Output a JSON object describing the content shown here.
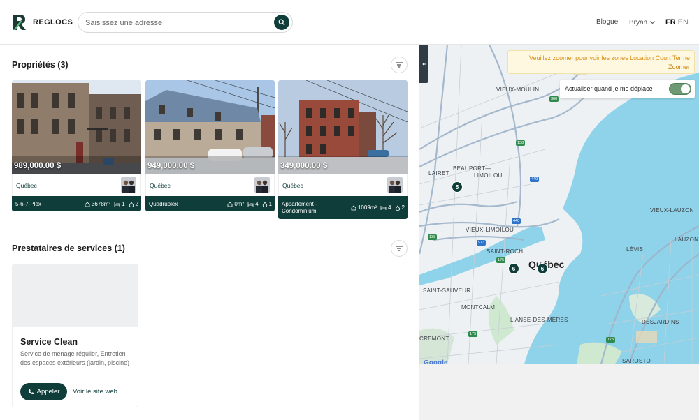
{
  "header": {
    "brand": "REGLOCS",
    "search_placeholder": "Saisissez une adresse",
    "nav_blog": "Blogue",
    "user_name": "Bryan",
    "lang_active": "FR",
    "lang_inactive": "EN"
  },
  "properties": {
    "title": "Propriétés (3)",
    "cards": [
      {
        "price": "989,000.00 $",
        "city": "Québec",
        "type": "5-6-7-Plex",
        "area": "3678m²",
        "beds": "1",
        "baths": "2"
      },
      {
        "price": "949,000.00 $",
        "city": "Québec",
        "type": "Quadruplex",
        "area": "0m²",
        "beds": "4",
        "baths": "1"
      },
      {
        "price": "349,000.00 $",
        "city": "Québec",
        "type": "Appartement - Condominium",
        "area": "1009m²",
        "beds": "4",
        "baths": "2"
      }
    ]
  },
  "services": {
    "title": "Prestataires de services (1)",
    "cards": [
      {
        "name": "Service Clean",
        "description": "Service de ménage régulier, Entretien des espaces extérieurs (jardin, piscine)",
        "call_label": "Appeler",
        "web_label": "Voir le site web"
      }
    ]
  },
  "map": {
    "notice_text": "Veuillez zoomer pour voir les zones Location Court Terme",
    "notice_link": "Zoomer",
    "toggle_label": "Actualiser quand je me déplace",
    "toggle_on": true,
    "pins": [
      "5",
      "6",
      "6"
    ],
    "labels": {
      "vieux_moulin": "VIEUX-MOULIN",
      "beauport": "BEAUPORT—",
      "limoilou": "LIMOILOU",
      "lairet": "LAIRET",
      "vieux_limoilou": "VIEUX-LIMOILOU",
      "saint_roch": "SAINT-ROCH",
      "quebec": "Québec",
      "saint_sauveur": "SAINT-SAUVEUR",
      "montcalm": "MONTCALM",
      "anse": "L'ANSE-DES-MÈRES",
      "cremont": "CREMONT",
      "vieux_lauzon": "VIEUX-LAUZON",
      "lauzon": "LAUZON",
      "levis": "LÉVIS",
      "desjardins": "DESJARDINS",
      "sarosto": "SAROSTO",
      "google": "Google"
    },
    "road_badges": [
      "360",
      "138",
      "440",
      "440",
      "973",
      "175",
      "138",
      "175",
      "175"
    ],
    "colors": {
      "water": "#8fd3ea",
      "land": "#eef1f3",
      "park": "#cfe8d0",
      "accent": "#0f3d3a"
    }
  }
}
